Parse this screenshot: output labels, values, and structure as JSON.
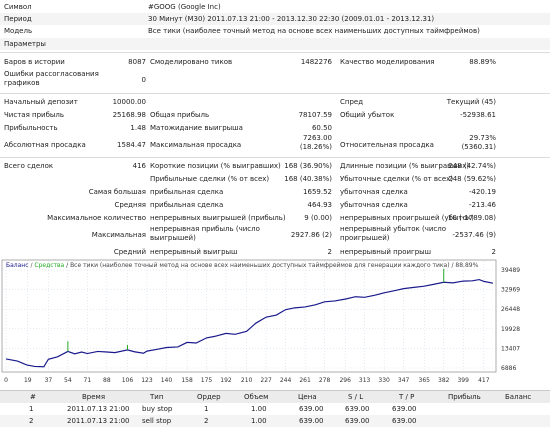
{
  "summary": {
    "symbol": {
      "label": "Символ",
      "value": "#GOOG (Google Inc)"
    },
    "period": {
      "label": "Период",
      "value": "30 Минут (M30) 2011.07.13 21:00 - 2013.12.30 22:30 (2009.01.01 - 2013.12.31)"
    },
    "model": {
      "label": "Модель",
      "value": "Все тики (наиболее точный метод на основе всех наименьших доступных таймфреймов)"
    },
    "params": {
      "label": "Параметры",
      "value": ""
    },
    "bars": {
      "label": "Баров в истории",
      "value": "8087",
      "label2": "Смоделировано тиков",
      "value2": "1482276",
      "label3": "Качество моделирования",
      "value3": "88.89%"
    },
    "errors": {
      "label": "Ошибки рассогласования графиков",
      "value": "0"
    },
    "deposit": {
      "label": "Начальный депозит",
      "value": "10000.00",
      "label3": "Спред",
      "value3": "Текущий (45)"
    },
    "net": {
      "label": "Чистая прибыль",
      "value": "25168.98",
      "label2": "Общая прибыль",
      "value2": "78107.59",
      "label3": "Общий убыток",
      "value3": "-52938.61"
    },
    "pf": {
      "label": "Прибыльность",
      "value": "1.48",
      "label2": "Матожидание выигрыша",
      "value2": "60.50"
    },
    "dd": {
      "label": "Абсолютная просадка",
      "value": "1584.47",
      "label2": "Максимальная просадка",
      "value2a": "7263.00",
      "value2b": "(18.26%)",
      "label3": "Относительная просадка",
      "value3a": "29.73%",
      "value3b": "(5360.31)"
    },
    "trades": {
      "label": "Всего сделок",
      "value": "416",
      "label2": "Короткие позиции (% выигравших)",
      "value2": "168 (36.90%)",
      "label3": "Длинные позиции (% выигравших)",
      "value3": "248 (42.74%)"
    },
    "profit_trades": {
      "label2": "Прибыльные сделки (% от всех)",
      "value2": "168 (40.38%)",
      "label3": "Убыточные сделки (% от всех)",
      "value3": "248 (59.62%)"
    },
    "largest": {
      "label": "Самая большая",
      "label2": "прибыльная сделка",
      "value2": "1659.52",
      "label3": "убыточная сделка",
      "value3": "-420.19"
    },
    "average": {
      "label": "Средняя",
      "label2": "прибыльная сделка",
      "value2": "464.93",
      "label3": "убыточная сделка",
      "value3": "-213.46"
    },
    "max_count": {
      "label": "Максимальное количество",
      "label2": "непрерывных выигрышей (прибыль)",
      "value2": "9 (0.00)",
      "label3": "непрерывных проигрышей (убыток)",
      "value3": "10 (-1789.08)"
    },
    "max_amount": {
      "label": "Максимальная",
      "label2a": "непрерывная прибыль (число",
      "label2b": "выигрышей)",
      "value2": "2927.86 (2)",
      "label3a": "непрерывный убыток (число",
      "label3b": "проигрышей)",
      "value3": "-2537.46 (9)"
    },
    "avg_cont": {
      "label": "Средний",
      "label2": "непрерывный выигрыш",
      "value2": "2",
      "label3": "непрерывный проигрыш",
      "value3": "2"
    }
  },
  "graph": {
    "legend_balance": "Баланс",
    "legend_sep": " / ",
    "legend_equity": "Средства",
    "legend_rest": " / Все тики (наиболее точный метод на основе всех наименьших доступных таймфреймов для генерации каждого тика) / 88.89%",
    "colors": {
      "balance": "#1a1a8c",
      "equity": "#22aa22",
      "grid": "#c8d4e4"
    }
  },
  "chart_data": {
    "type": "line",
    "x_ticks": [
      0,
      19,
      37,
      54,
      71,
      88,
      106,
      123,
      140,
      158,
      175,
      192,
      210,
      227,
      244,
      261,
      278,
      296,
      313,
      330,
      347,
      365,
      382,
      399,
      417
    ],
    "y_ticks": [
      6886,
      13407,
      19928,
      26448,
      32969,
      39489
    ],
    "ylim": [
      6886,
      39489
    ],
    "xlim": [
      0,
      425
    ],
    "series": [
      {
        "values": [
          [
            0,
            9900
          ],
          [
            10,
            9200
          ],
          [
            18,
            7900
          ],
          [
            25,
            7400
          ],
          [
            33,
            7300
          ],
          [
            37,
            9800
          ],
          [
            45,
            10600
          ],
          [
            54,
            12400
          ],
          [
            60,
            11600
          ],
          [
            66,
            12200
          ],
          [
            71,
            11700
          ],
          [
            80,
            12400
          ],
          [
            88,
            12200
          ],
          [
            95,
            12000
          ],
          [
            106,
            12900
          ],
          [
            112,
            12300
          ],
          [
            120,
            11800
          ],
          [
            123,
            12500
          ],
          [
            132,
            13100
          ],
          [
            140,
            13700
          ],
          [
            150,
            13900
          ],
          [
            158,
            15400
          ],
          [
            166,
            15200
          ],
          [
            175,
            16900
          ],
          [
            182,
            17400
          ],
          [
            192,
            18400
          ],
          [
            200,
            18100
          ],
          [
            210,
            19100
          ],
          [
            218,
            21800
          ],
          [
            227,
            23800
          ],
          [
            236,
            24500
          ],
          [
            244,
            26300
          ],
          [
            252,
            26900
          ],
          [
            261,
            27200
          ],
          [
            270,
            27900
          ],
          [
            278,
            28900
          ],
          [
            287,
            29200
          ],
          [
            296,
            29800
          ],
          [
            305,
            30600
          ],
          [
            313,
            30400
          ],
          [
            322,
            31100
          ],
          [
            330,
            31900
          ],
          [
            340,
            32700
          ],
          [
            347,
            33300
          ],
          [
            356,
            33700
          ],
          [
            365,
            34100
          ],
          [
            373,
            34700
          ],
          [
            382,
            35400
          ],
          [
            390,
            35200
          ],
          [
            399,
            35800
          ],
          [
            407,
            35900
          ],
          [
            413,
            36300
          ],
          [
            417,
            35700
          ],
          [
            425,
            35100
          ]
        ]
      },
      {
        "values": [
          [
            54,
            12400
          ],
          [
            54,
            15800
          ],
          [
            106,
            12900
          ],
          [
            106,
            14600
          ],
          [
            382,
            35400
          ],
          [
            382,
            39900
          ]
        ]
      }
    ]
  },
  "table": {
    "headers": [
      "#",
      "Время",
      "Тип",
      "Ордер",
      "Объем",
      "Цена",
      "S / L",
      "T / P",
      "Прибыль",
      "Баланс"
    ],
    "rows": [
      [
        "1",
        "2011.07.13 21:00",
        "buy stop",
        "1",
        "1.00",
        "639.00",
        "639.00",
        "639.00",
        "",
        ""
      ],
      [
        "2",
        "2011.07.13 21:00",
        "sell stop",
        "2",
        "1.00",
        "639.00",
        "639.00",
        "639.00",
        "",
        ""
      ]
    ]
  }
}
